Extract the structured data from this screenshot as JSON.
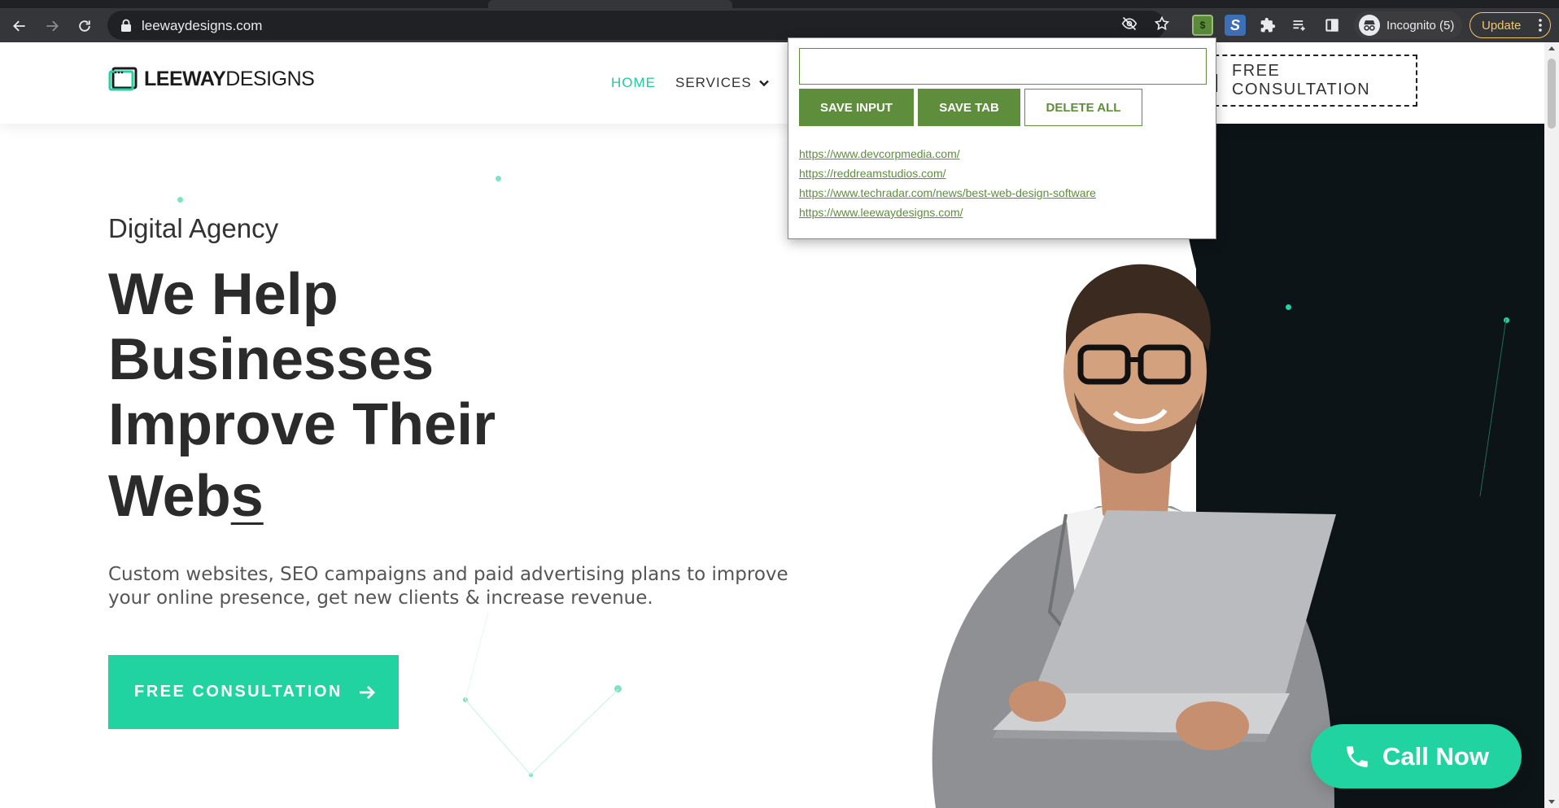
{
  "browser": {
    "url": "leewaydesigns.com",
    "incognito_label": "Incognito (5)",
    "update_label": "Update",
    "extension_badge": "$",
    "extension_s": "S"
  },
  "site": {
    "logo_bold": "LEEWAY",
    "logo_light": "DESIGNS",
    "nav": {
      "home": "HOME",
      "services": "SERVICES"
    },
    "header_cta": "FREE CONSULTATION",
    "hero": {
      "subtitle": "Digital Agency",
      "headline_lines": [
        "We Help",
        "Businesses",
        "Improve Their"
      ],
      "headline_typed": "Web",
      "headline_cursor_char": "s",
      "lead": "Custom websites, SEO campaigns and paid advertising plans to improve your online presence, get new clients & increase revenue.",
      "cta": "FREE CONSULTATION"
    },
    "call_now": "Call Now"
  },
  "popup": {
    "input_value": "",
    "save_input": "SAVE INPUT",
    "save_tab": "SAVE TAB",
    "delete_all": "DELETE ALL",
    "links": [
      "https://www.devcorpmedia.com/",
      "https://reddreamstudios.com/",
      "https://www.techradar.com/news/best-web-design-software",
      "https://www.leewaydesigns.com/"
    ]
  },
  "colors": {
    "accent": "#22d3a2",
    "nav_active": "#22c9a0",
    "popup_green": "#5e8d3c",
    "dark_panel": "#0d1417",
    "chrome_bg": "#35363a",
    "update": "#f4c56b"
  },
  "icons": {
    "back": "back-arrow-icon",
    "forward": "forward-arrow-icon",
    "reload": "reload-icon",
    "lock": "lock-icon",
    "eye_off": "eye-off-icon",
    "star": "star-icon",
    "puzzle": "puzzle-icon",
    "reading_list": "reading-list-icon",
    "side_panel": "side-panel-icon",
    "more": "more-vert-icon",
    "chevron": "chevron-down-icon",
    "arrow_right": "arrow-right-icon",
    "phone": "phone-icon"
  }
}
